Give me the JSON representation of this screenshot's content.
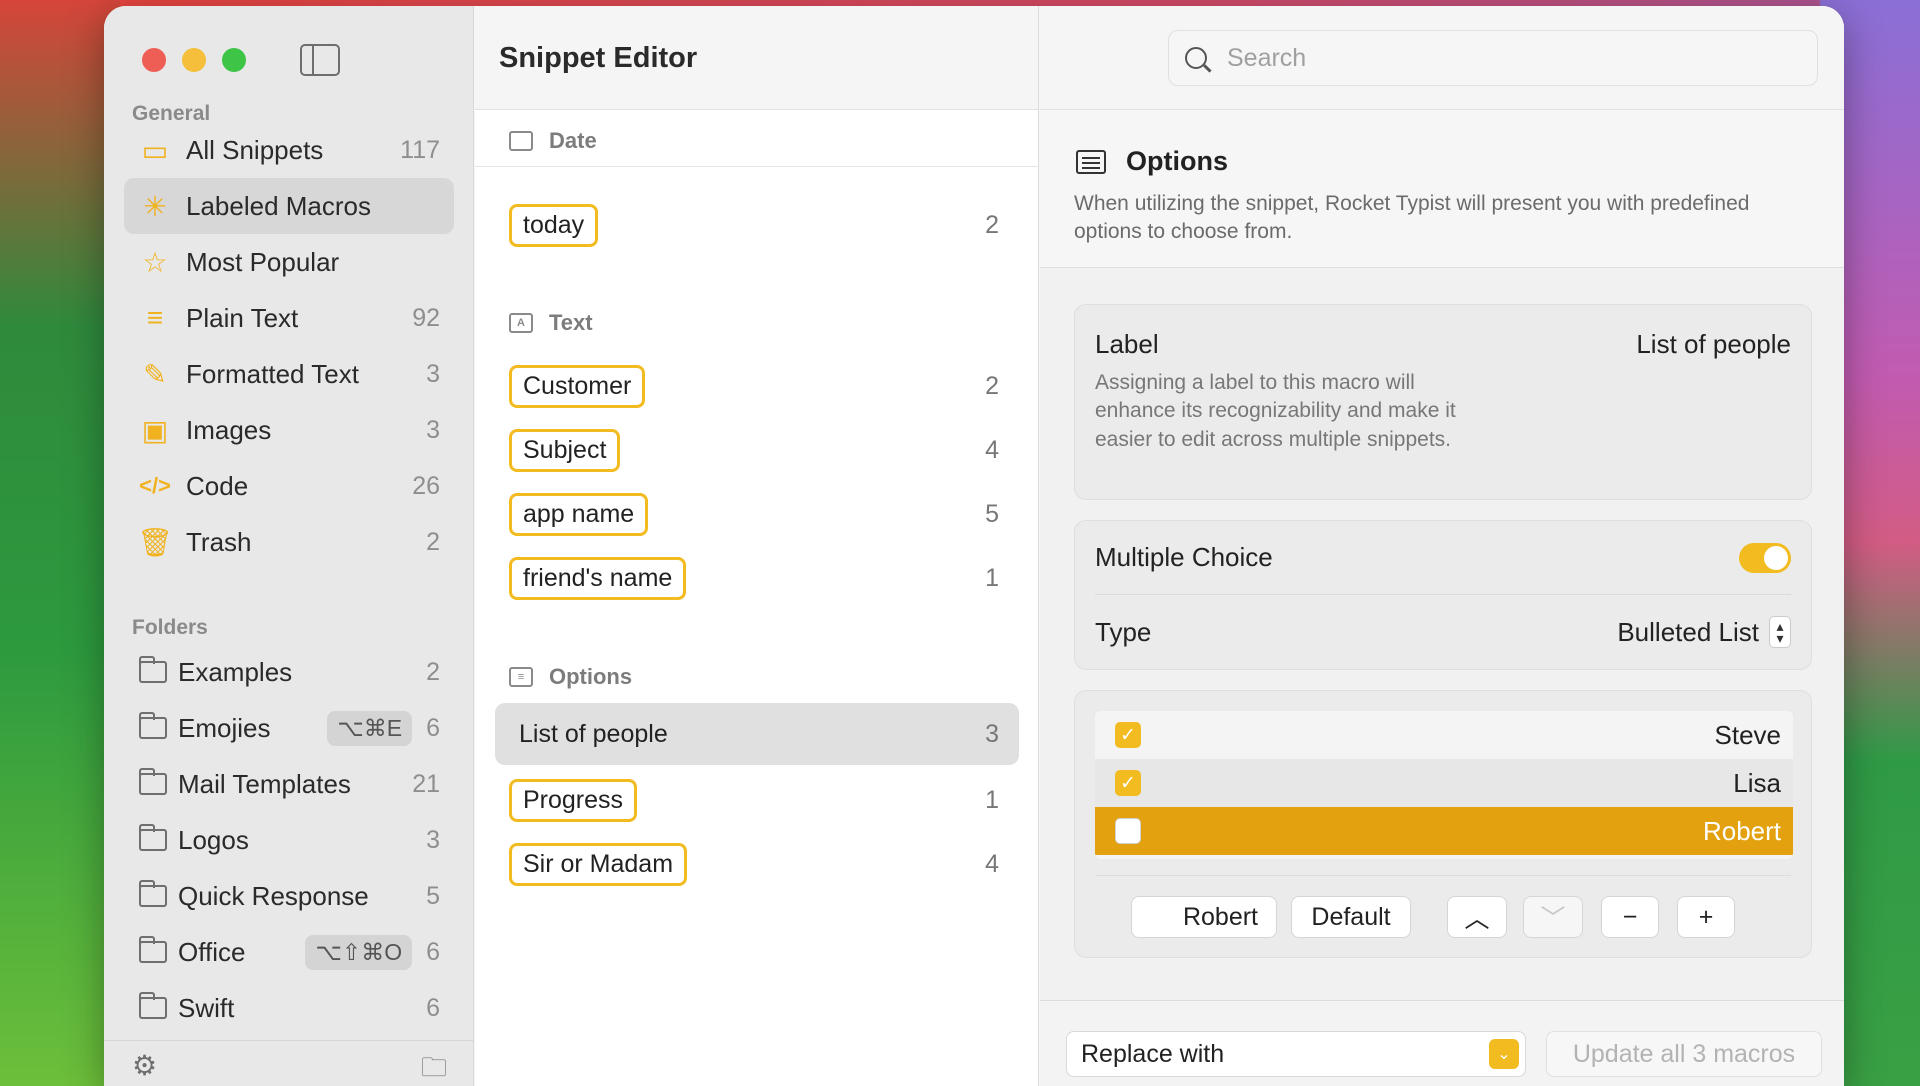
{
  "window": {
    "app_title": "Snippet Editor"
  },
  "search": {
    "placeholder": "Search"
  },
  "sidebar": {
    "general_title": "General",
    "folders_title": "Folders",
    "general": [
      {
        "label": "All Snippets",
        "count": "117",
        "icon": "stack-icon"
      },
      {
        "label": "Labeled Macros",
        "count": "",
        "icon": "sparkle-icon"
      },
      {
        "label": "Most Popular",
        "count": "",
        "icon": "star-icon"
      },
      {
        "label": "Plain Text",
        "count": "92",
        "icon": "lines-icon"
      },
      {
        "label": "Formatted Text",
        "count": "3",
        "icon": "brush-icon"
      },
      {
        "label": "Images",
        "count": "3",
        "icon": "image-icon"
      },
      {
        "label": "Code",
        "count": "26",
        "icon": "code-icon"
      },
      {
        "label": "Trash",
        "count": "2",
        "icon": "trash-icon"
      }
    ],
    "folders": [
      {
        "label": "Examples",
        "count": "2",
        "shortcut": ""
      },
      {
        "label": "Emojies",
        "count": "6",
        "shortcut": "⌥⌘E"
      },
      {
        "label": "Mail Templates",
        "count": "21",
        "shortcut": ""
      },
      {
        "label": "Logos",
        "count": "3",
        "shortcut": ""
      },
      {
        "label": "Quick Response",
        "count": "5",
        "shortcut": ""
      },
      {
        "label": "Office",
        "count": "6",
        "shortcut": "⌥⇧⌘O"
      },
      {
        "label": "Swift",
        "count": "6",
        "shortcut": ""
      }
    ]
  },
  "macros": {
    "groups": [
      {
        "title": "Date",
        "items": [
          {
            "name": "today",
            "count": "2"
          }
        ]
      },
      {
        "title": "Text",
        "items": [
          {
            "name": "Customer",
            "count": "2"
          },
          {
            "name": "Subject",
            "count": "4"
          },
          {
            "name": "app name",
            "count": "5"
          },
          {
            "name": "friend's name",
            "count": "1"
          }
        ]
      },
      {
        "title": "Options",
        "items": [
          {
            "name": "List of people",
            "count": "3"
          },
          {
            "name": "Progress",
            "count": "1"
          },
          {
            "name": "Sir or Madam",
            "count": "4"
          }
        ]
      }
    ]
  },
  "options": {
    "title": "Options",
    "description": "When utilizing the snippet, Rocket Typist will present you with predefined options to choose from.",
    "label_title": "Label",
    "label_value": "List of people",
    "label_description": "Assigning a label to this macro will enhance its recognizability and make it easier to edit across multiple snippets.",
    "multiple_choice_label": "Multiple Choice",
    "multiple_choice_on": true,
    "type_label": "Type",
    "type_value": "Bulleted List",
    "list": [
      {
        "name": "Steve",
        "checked": true
      },
      {
        "name": "Lisa",
        "checked": true
      },
      {
        "name": "Robert",
        "checked": false
      }
    ],
    "edit_value": "Robert",
    "default_button": "Default",
    "replace_label": "Replace with",
    "update_button": "Update all 3 macros"
  },
  "colors": {
    "accent": "#f2bb1f",
    "selection": "#e3a10f"
  }
}
